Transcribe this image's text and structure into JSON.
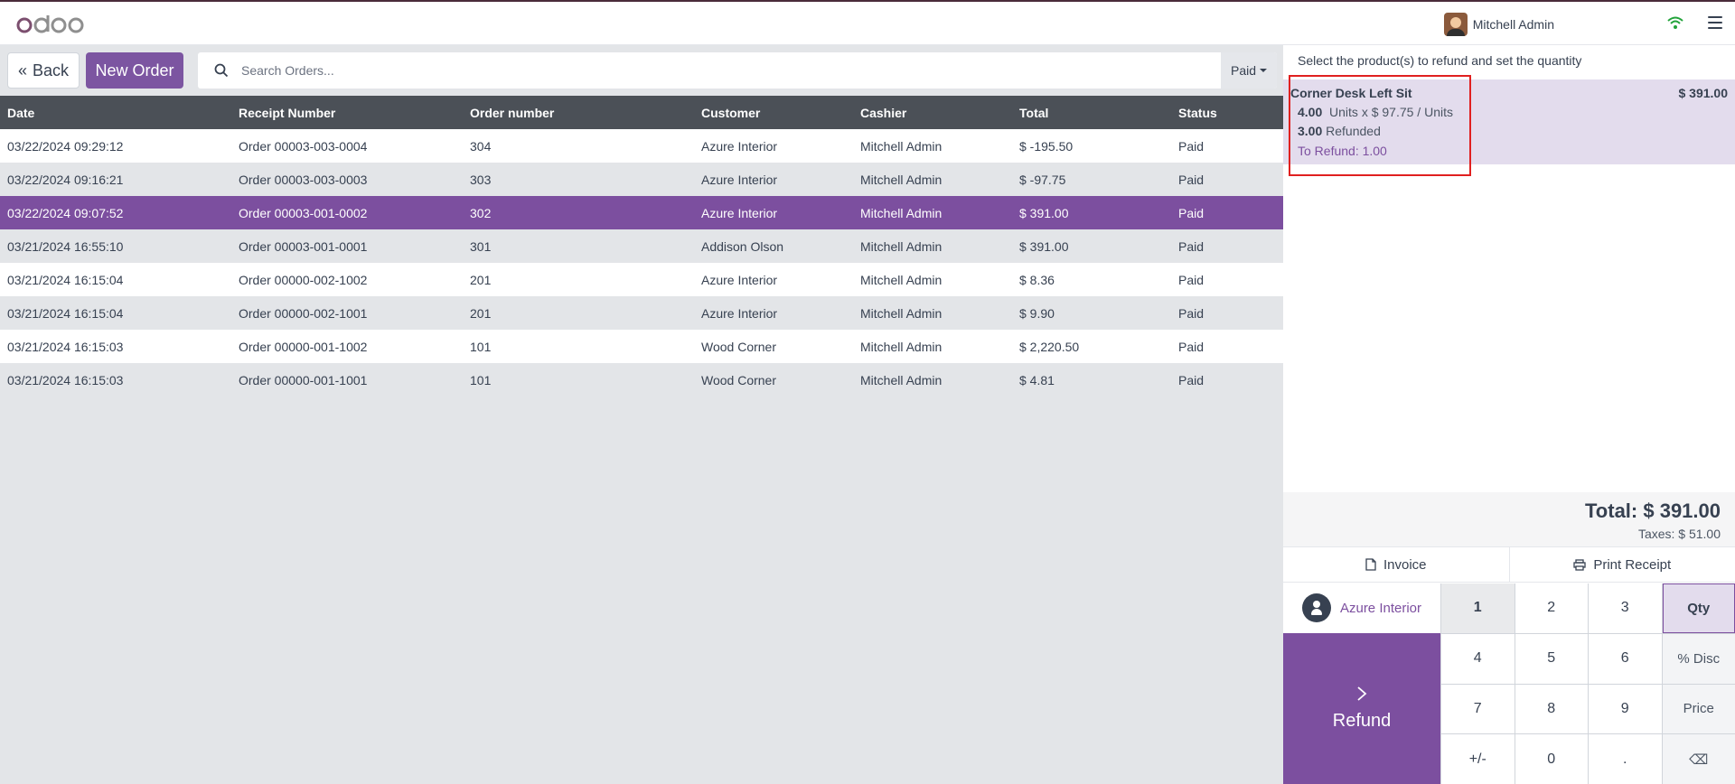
{
  "app": {
    "logo_text": "odoo",
    "user_name": "Mitchell Admin"
  },
  "toolbar": {
    "back_label": "Back",
    "new_order_label": "New Order",
    "search_placeholder": "Search Orders...",
    "filter_label": "Paid"
  },
  "orders": {
    "headers": [
      "Date",
      "Receipt Number",
      "Order number",
      "Customer",
      "Cashier",
      "Total",
      "Status"
    ],
    "rows": [
      {
        "date": "03/22/2024 09:29:12",
        "receipt": "Order 00003-003-0004",
        "number": "304",
        "customer": "Azure Interior",
        "cashier": "Mitchell Admin",
        "total": "$ -195.50",
        "status": "Paid"
      },
      {
        "date": "03/22/2024 09:16:21",
        "receipt": "Order 00003-003-0003",
        "number": "303",
        "customer": "Azure Interior",
        "cashier": "Mitchell Admin",
        "total": "$ -97.75",
        "status": "Paid"
      },
      {
        "date": "03/22/2024 09:07:52",
        "receipt": "Order 00003-001-0002",
        "number": "302",
        "customer": "Azure Interior",
        "cashier": "Mitchell Admin",
        "total": "$ 391.00",
        "status": "Paid"
      },
      {
        "date": "03/21/2024 16:55:10",
        "receipt": "Order 00003-001-0001",
        "number": "301",
        "customer": "Addison Olson",
        "cashier": "Mitchell Admin",
        "total": "$ 391.00",
        "status": "Paid"
      },
      {
        "date": "03/21/2024 16:15:04",
        "receipt": "Order 00000-002-1002",
        "number": "201",
        "customer": "Azure Interior",
        "cashier": "Mitchell Admin",
        "total": "$ 8.36",
        "status": "Paid"
      },
      {
        "date": "03/21/2024 16:15:04",
        "receipt": "Order 00000-002-1001",
        "number": "201",
        "customer": "Azure Interior",
        "cashier": "Mitchell Admin",
        "total": "$ 9.90",
        "status": "Paid"
      },
      {
        "date": "03/21/2024 16:15:03",
        "receipt": "Order 00000-001-1002",
        "number": "101",
        "customer": "Wood Corner",
        "cashier": "Mitchell Admin",
        "total": "$ 2,220.50",
        "status": "Paid"
      },
      {
        "date": "03/21/2024 16:15:03",
        "receipt": "Order 00000-001-1001",
        "number": "101",
        "customer": "Wood Corner",
        "cashier": "Mitchell Admin",
        "total": "$ 4.81",
        "status": "Paid"
      }
    ],
    "selected_index": 2
  },
  "refund": {
    "title": "Select the product(s) to refund and set the quantity",
    "line": {
      "product": "Corner Desk Left Sit",
      "price": "$ 391.00",
      "qty": "4.00",
      "unit_info": "Units x $ 97.75 / Units",
      "refunded_qty": "3.00",
      "refunded_label": "Refunded",
      "to_refund": "To Refund: 1.00"
    },
    "total": "Total: $ 391.00",
    "taxes": "Taxes: $ 51.00",
    "invoice_label": "Invoice",
    "print_label": "Print Receipt",
    "customer": "Azure Interior",
    "refund_label": "Refund"
  },
  "numpad": {
    "keys": [
      "1",
      "2",
      "3",
      "Qty",
      "4",
      "5",
      "6",
      "% Disc",
      "7",
      "8",
      "9",
      "Price",
      "+/-",
      "0",
      ".",
      "⌫"
    ]
  },
  "colors": {
    "primary": "#7c4f9f",
    "header_bg": "#4b5057",
    "selected_line_bg": "#e3dced",
    "highlight_border": "#e02020"
  }
}
